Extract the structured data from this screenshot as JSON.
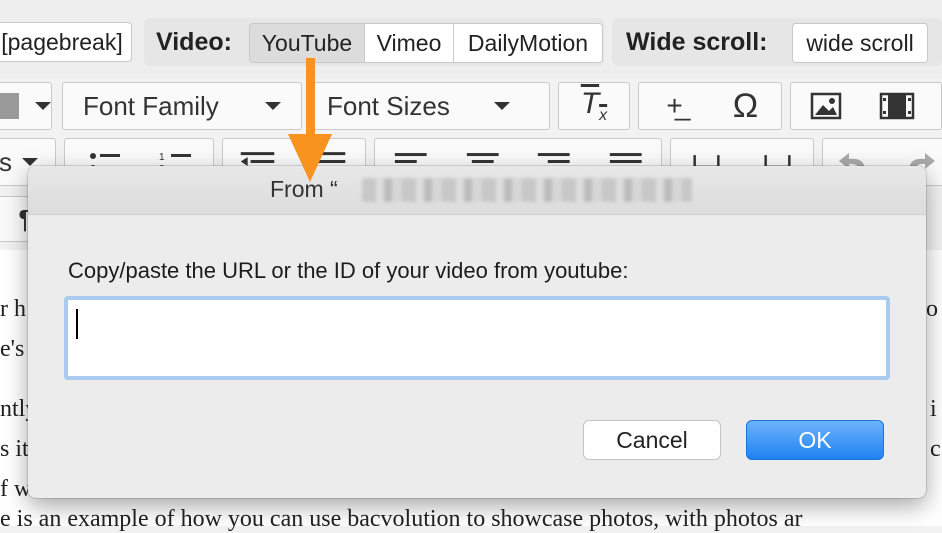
{
  "toolbar": {
    "pagebreak_label": "[pagebreak]",
    "video_label": "Video:",
    "video_options": [
      "YouTube",
      "Vimeo",
      "DailyMotion"
    ],
    "wide_scroll_label": "Wide scroll:",
    "wide_scroll_button": "wide scroll",
    "font_family": "Font Family",
    "font_sizes": "Font Sizes",
    "omega": "Ω",
    "row2_left": "s"
  },
  "document": {
    "line_fragments": [
      {
        "left": "r h",
        "right": "o"
      },
      {
        "left": "e's",
        "right": ""
      },
      {
        "left": "ntly",
        "right": "i"
      },
      {
        "left": "s it",
        "right": "c"
      },
      {
        "left": "f w",
        "right": ""
      },
      {
        "left": "e is an example of how you can use bacvolution to showcase photos, with photos ar",
        "right": ""
      }
    ]
  },
  "dialog": {
    "title_prefix": "From “",
    "prompt": "Copy/paste the URL or the ID of your video from youtube:",
    "input_value": "",
    "input_placeholder": "",
    "cancel_label": "Cancel",
    "ok_label": "OK"
  },
  "colors": {
    "accent_arrow": "#f7931e",
    "ok_button": "#1f82f3",
    "input_focus": "#a9cbf0"
  }
}
